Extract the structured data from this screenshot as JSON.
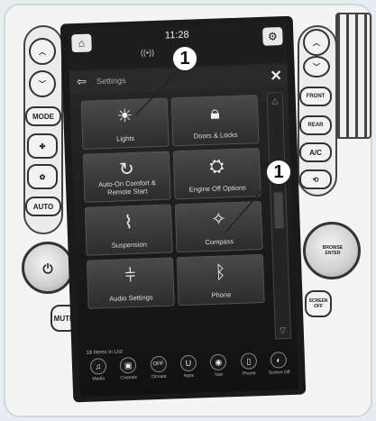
{
  "status": {
    "time": "11:28"
  },
  "menu": {
    "title": "Settings"
  },
  "tiles": [
    {
      "label": "Lights",
      "icon": "light-icon"
    },
    {
      "label": "Doors & Locks",
      "icon": "lock-icon"
    },
    {
      "label": "Auto-On Comfort & Remote Start",
      "icon": "auto-on-icon"
    },
    {
      "label": "Engine Off Options",
      "icon": "engine-icon"
    },
    {
      "label": "Suspension",
      "icon": "suspension-icon"
    },
    {
      "label": "Compass",
      "icon": "compass-icon"
    },
    {
      "label": "Audio Settings",
      "icon": "equalizer-icon"
    },
    {
      "label": "Phone",
      "icon": "bluetooth-icon"
    }
  ],
  "list": {
    "count_text": "18 Items in List"
  },
  "dock": [
    {
      "label": "Media",
      "glyph": "♫"
    },
    {
      "label": "Controls",
      "glyph": "▣"
    },
    {
      "label": "Climate",
      "glyph": "OFF"
    },
    {
      "label": "Apps",
      "glyph": "U"
    },
    {
      "label": "Nav",
      "glyph": "◉"
    },
    {
      "label": "Phone",
      "glyph": "▯"
    },
    {
      "label": "Screen Off",
      "glyph": "◐"
    }
  ],
  "left_panel": {
    "mode_label": "MODE",
    "auto_label": "AUTO",
    "mute_label": "MUTE"
  },
  "right_panel": {
    "front_label": "FRONT",
    "rear_label": "REAR",
    "ac_label": "A/C",
    "browse_label": "BROWSE ENTER",
    "screen_label": "SCREEN OFF"
  },
  "callouts": [
    "1",
    "1"
  ]
}
